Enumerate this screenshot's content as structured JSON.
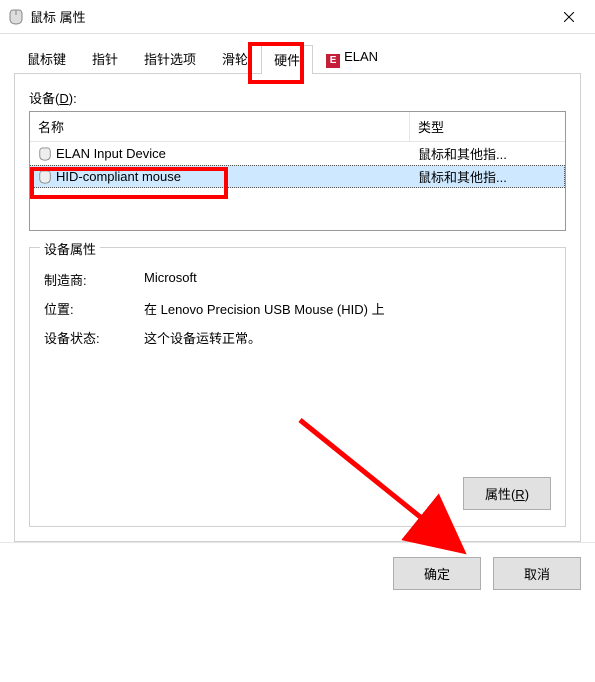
{
  "window": {
    "title": "鼠标 属性"
  },
  "tabs": {
    "mouse_keys": "鼠标键",
    "pointer": "指针",
    "pointer_options": "指针选项",
    "wheel": "滑轮",
    "hardware": "硬件",
    "elan": "ELAN"
  },
  "hardware": {
    "devices_label_pre": "设备(",
    "devices_label_key": "D",
    "devices_label_post": "):",
    "columns": {
      "name": "名称",
      "type": "类型"
    },
    "rows": [
      {
        "name": "ELAN Input Device",
        "type": "鼠标和其他指..."
      },
      {
        "name": "HID-compliant mouse",
        "type": "鼠标和其他指..."
      }
    ],
    "properties_legend": "设备属性",
    "manufacturer_label": "制造商:",
    "manufacturer_value": "Microsoft",
    "location_label": "位置:",
    "location_value": "在 Lenovo Precision USB Mouse (HID) 上",
    "status_label": "设备状态:",
    "status_value": "这个设备运转正常。",
    "properties_button_pre": "属性(",
    "properties_button_key": "R",
    "properties_button_post": ")"
  },
  "footer": {
    "ok": "确定",
    "cancel": "取消"
  }
}
